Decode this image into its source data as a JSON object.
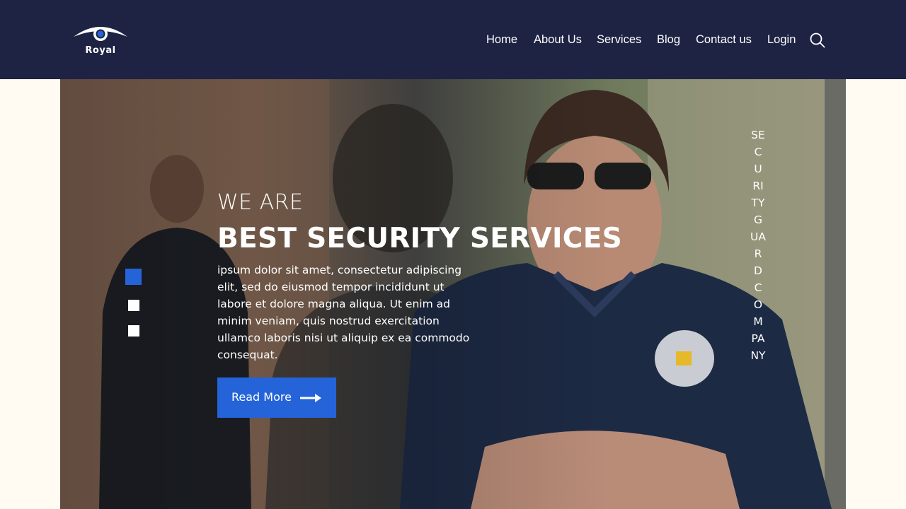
{
  "brand": {
    "name": "Royal",
    "accent": "#2563d9",
    "header_bg": "#1e2343"
  },
  "nav": {
    "items": [
      {
        "label": "Home"
      },
      {
        "label": "About Us"
      },
      {
        "label": "Services"
      },
      {
        "label": "Blog"
      },
      {
        "label": "Contact us"
      },
      {
        "label": "Login"
      }
    ],
    "search_icon": "search-icon"
  },
  "hero": {
    "kicker": "WE ARE",
    "title": "BEST SECURITY SERVICES",
    "text": "ipsum dolor sit amet, consectetur adipiscing elit, sed do eiusmod tempor incididunt ut labore et dolore magna aliqua. Ut enim ad minim veniam, quis nostrud exercitation ullamco laboris nisi ut aliquip ex ea commodo consequat.",
    "button_label": "Read More",
    "button_icon": "arrow-right-icon",
    "vertical_text": "SECURITYGUARDCOMPANY",
    "slides": {
      "count": 3,
      "active": 1
    }
  }
}
